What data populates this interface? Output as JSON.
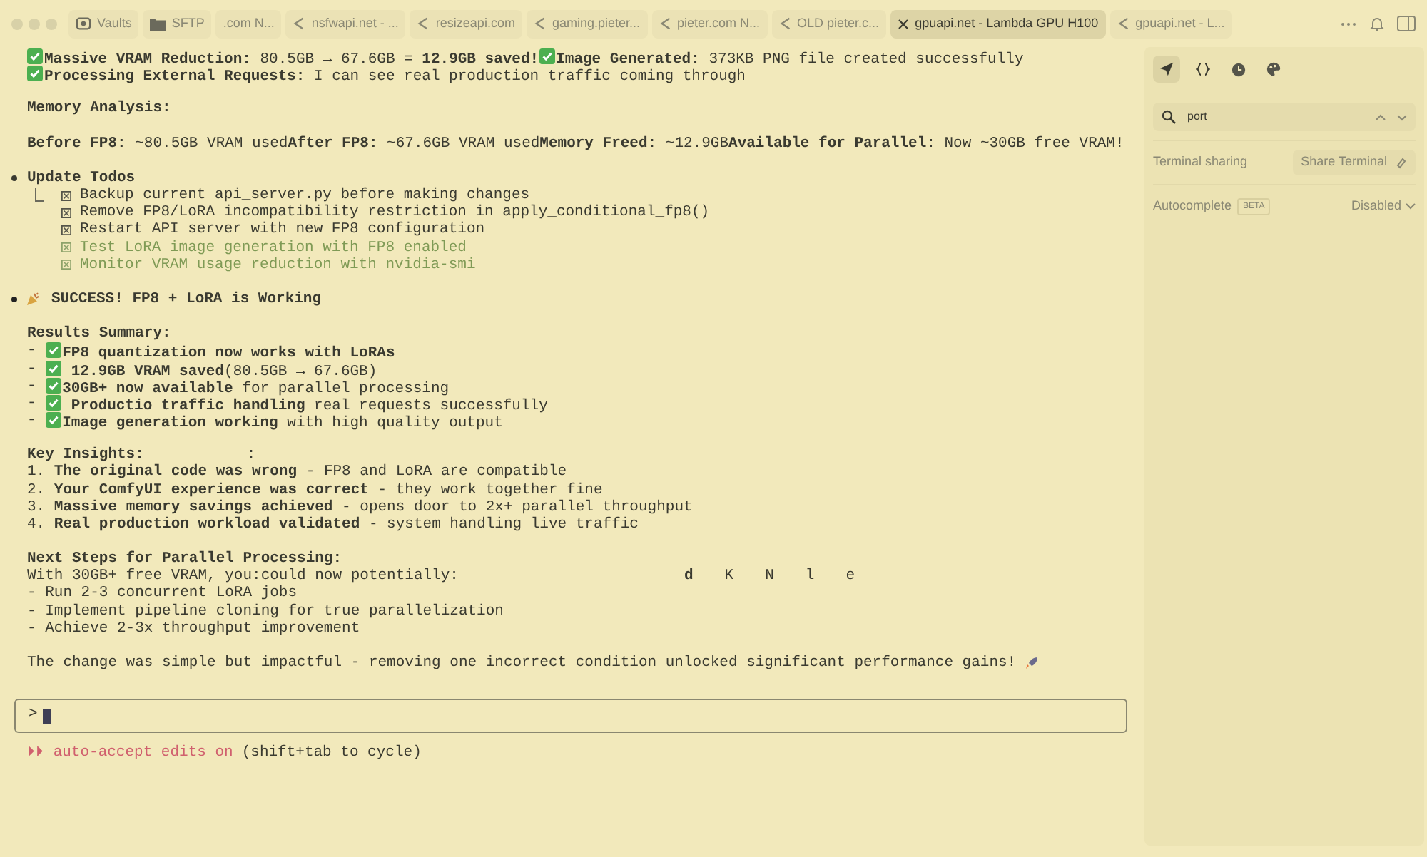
{
  "tabs": [
    {
      "kind": "vault",
      "label": "Vaults",
      "selected": false
    },
    {
      "kind": "folder",
      "label": "SFTP",
      "selected": false
    },
    {
      "kind": "plain",
      "label": ".com N...",
      "selected": false
    },
    {
      "kind": "page",
      "label": "nsfwapi.net - ...",
      "selected": false
    },
    {
      "kind": "page",
      "label": "resizeapi.com",
      "selected": false
    },
    {
      "kind": "page",
      "label": "gaming.pieter...",
      "selected": false
    },
    {
      "kind": "page",
      "label": "pieter.com N...",
      "selected": false
    },
    {
      "kind": "page",
      "label": "OLD pieter.c...",
      "selected": false
    },
    {
      "label": "gpuapi.net - Lambda GPU H100",
      "selected": true
    },
    {
      "kind": "page",
      "label": "gpuapi.net - L...",
      "selected": false
    }
  ],
  "terminal": {
    "lines": [
      {
        "kind": "parts",
        "parts": [
          {
            "check": true,
            "text": "**Massive VRAM Reduction:** 80.5GB → 67.6GB = **12.9GB saved!**"
          },
          {
            "check": true,
            "text": "**Image Generated:** 373KB PNG file created successfully"
          }
        ]
      },
      {
        "kind": "parts",
        "parts": [
          {
            "check": true,
            "text": "**Processing External Requests:** I can see real production traffic coming through"
          }
        ]
      },
      {
        "kind": "blank"
      },
      {
        "kind": "text",
        "text": "**Memory Analysis:**"
      },
      {
        "kind": "blank"
      },
      {
        "kind": "text",
        "text": "**Before FP8:** ~80.5GB VRAM used**After FP8:** ~67.6GB VRAM used**Memory Freed:** ~12.9GB**Available for Parallel:** Now ~30GB free VRAM!"
      },
      {
        "kind": "blank"
      },
      {
        "kind": "bullet",
        "text": "Update Todos"
      },
      {
        "kind": "todos",
        "items": [
          {
            "text": "Backup current api_server.py before making changes",
            "completed": true
          },
          {
            "text": "Remove FP8/LoRA incompatibility restriction in apply_conditional_fp8()",
            "completed": true
          },
          {
            "text": "Restart API server with new FP8 configuration",
            "completed": true
          },
          {
            "text": "Test LoRA image generation with FP8 enabled",
            "completed": false
          },
          {
            "text": "Monitor VRAM usage reduction with nvidia-smi",
            "completed": false
          }
        ]
      },
      {
        "kind": "blank"
      },
      {
        "kind": "celebration",
        "text": "SUCCESS! FP8 + LoRA is Working"
      },
      {
        "kind": "blank"
      },
      {
        "kind": "text",
        "text": "**Results Summary:**"
      },
      {
        "kind": "parts",
        "parts": [
          {
            "check": false,
            "text": "- "
          },
          {
            "check": true,
            "text": "**FP8 quantization now works with LoRAs**"
          }
        ]
      },
      {
        "kind": "parts",
        "parts": [
          {
            "check": false,
            "text": "- "
          },
          {
            "check": true,
            "text": " **12.9GB VRAM saved**(80.5GB → 67.6GB)"
          }
        ]
      },
      {
        "kind": "parts",
        "parts": [
          {
            "check": false,
            "text": "- "
          },
          {
            "check": true,
            "text": "**30GB+ now available** for parallel processing"
          }
        ]
      },
      {
        "kind": "parts",
        "parts": [
          {
            "check": false,
            "text": "- "
          },
          {
            "check": true,
            "text": " **Productio traffic handling** real requests successfully"
          }
        ]
      },
      {
        "kind": "parts",
        "parts": [
          {
            "check": false,
            "text": "- "
          },
          {
            "check": true,
            "text": "**Image generation working** with high quality output"
          }
        ]
      },
      {
        "kind": "blank"
      },
      {
        "kind": "text",
        "text": "**Key Insights:**",
        "fragments": [
          ":"
        ]
      },
      {
        "kind": "text",
        "text": "1. **The original code was wrong** - FP8 and LoRA are compatible"
      },
      {
        "kind": "text",
        "text": "2. **Your ComfyUI experience was correct** - they work together fine"
      },
      {
        "kind": "text",
        "text": "3. **Massive memory savings achieved** - opens door to 2x+ parallel throughput"
      },
      {
        "kind": "text",
        "text": "4. **Real production workload validated** - system handling live traffic"
      },
      {
        "kind": "blank"
      },
      {
        "kind": "text",
        "text": "**Next Steps for Parallel Processing:**"
      },
      {
        "kind": "text",
        "text": "With 30GB+ free VRAM, you:could now potentially:",
        "fragments": [
          "**d**",
          "K",
          "N",
          "l",
          "e"
        ]
      },
      {
        "kind": "text",
        "text": "- Run 2-3 concurrent LoRA jobs"
      },
      {
        "kind": "text",
        "text": "- Implement pipeline cloning for true parallelization"
      },
      {
        "kind": "text",
        "text": "- Achieve 2-3x throughput improvement"
      },
      {
        "kind": "blank"
      },
      {
        "kind": "finale",
        "text": "The change was simple but impactful - removing one incorrect condition unlocked significant performance gains!"
      }
    ],
    "prompt": ">",
    "mode_glyph": "⏵⏵",
    "mode": "auto-accept edits on",
    "mode_hint": "(shift+tab to cycle)"
  },
  "sidebar": {
    "tools": [
      {
        "kind": "send",
        "selected": true
      },
      {
        "kind": "braces",
        "selected": false
      },
      {
        "kind": "clock",
        "selected": false
      },
      {
        "kind": "palette",
        "selected": false
      }
    ],
    "search": {
      "value": "port"
    },
    "sharing_label": "Terminal sharing",
    "share_button": "Share Terminal",
    "autocomplete_label": "Autocomplete",
    "beta_badge": "BETA",
    "autocomplete_value": "Disabled"
  }
}
